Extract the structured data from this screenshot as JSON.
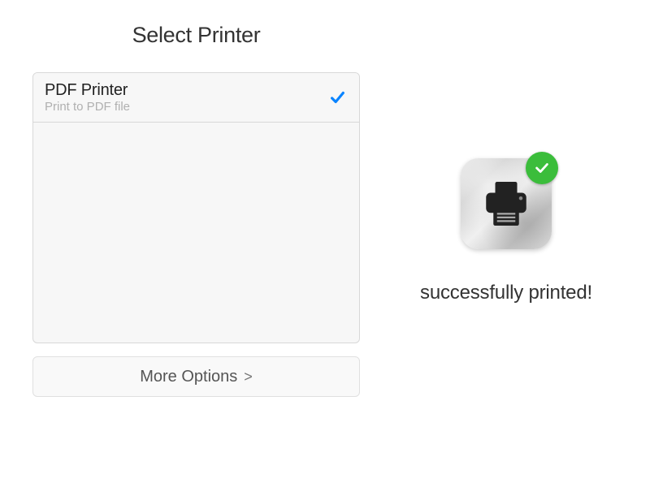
{
  "title": "Select Printer",
  "printer": {
    "name": "PDF Printer",
    "description": "Print to PDF file",
    "selected": true
  },
  "more_options_label": "More Options",
  "status": {
    "message": "successfully printed!",
    "success": true
  },
  "colors": {
    "accent": "#0a84ff",
    "success": "#3bbd3b"
  }
}
